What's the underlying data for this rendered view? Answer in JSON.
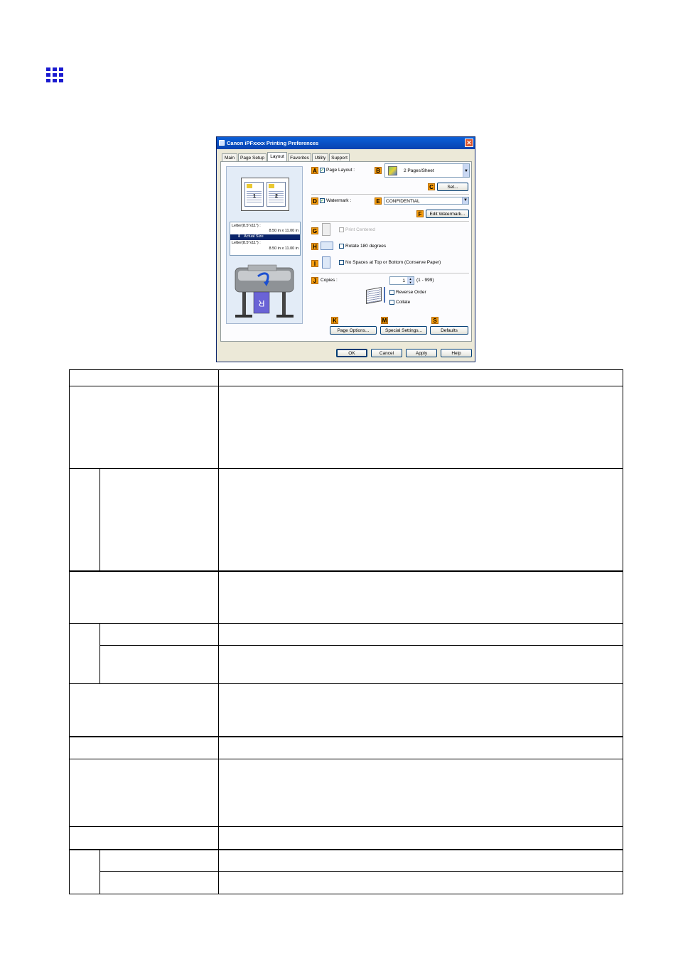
{
  "dialog": {
    "title": "Canon iPFxxxx Printing Preferences",
    "close_glyph": "✕",
    "tabs": [
      "Main",
      "Page Setup",
      "Layout",
      "Favorites",
      "Utility",
      "Support"
    ],
    "active_tab": "Layout",
    "preview": {
      "page_numbers": [
        "1",
        "2"
      ],
      "size_original_line1": "Letter(8.5\"x11\") :",
      "size_original_line2": "8.50 in x 11.00 in",
      "size_mode": "Actual Size",
      "size_output_line1": "Letter(8.5\"x11\") :",
      "size_output_line2": "8.50 in x 11.00 in",
      "printer_paper_glyph": "R"
    },
    "letters": {
      "A": "A",
      "B": "B",
      "C": "C",
      "D": "D",
      "E": "E",
      "F": "F",
      "G": "G",
      "H": "H",
      "I": "I",
      "J": "J",
      "K": "K",
      "M": "M",
      "S": "S"
    },
    "page_layout_label": "Page Layout :",
    "page_layout_value": "2 Pages/Sheet",
    "set_button": "Set...",
    "watermark_label": "Watermark :",
    "watermark_value": "CONFIDENTIAL",
    "edit_watermark_button": "Edit Watermark...",
    "print_centered_label": "Print Centered",
    "rotate_label": "Rotate 180 degrees",
    "no_spaces_label": "No Spaces at Top or Bottom (Conserve Paper)",
    "copies_label": "Copies :",
    "copies_value": "1",
    "copies_range": "(1 - 999)",
    "reverse_order_label": "Reverse Order",
    "collate_label": "Collate",
    "page_options_button": "Page Options...",
    "special_settings_button": "Special Settings...",
    "defaults_button": "Defaults",
    "ok_button": "OK",
    "cancel_button": "Cancel",
    "apply_button": "Apply",
    "help_button": "Help",
    "check_glyph": "✓",
    "spin_up_glyph": "▲",
    "spin_down_glyph": "▼",
    "dropdown_glyph": "▼",
    "arrow_down_glyph": "⬇"
  }
}
